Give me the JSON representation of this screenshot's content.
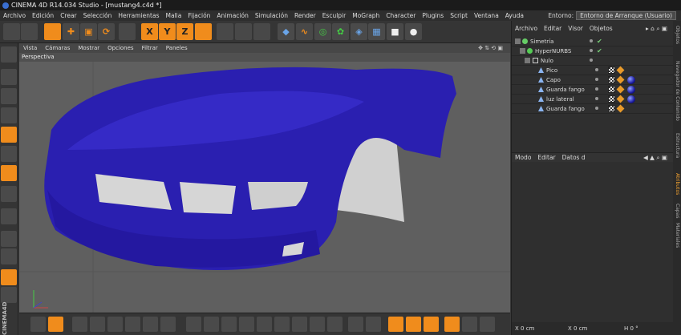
{
  "window": {
    "title": "CINEMA 4D R14.034 Studio - [mustang4.c4d *]"
  },
  "menu": [
    "Archivo",
    "Edición",
    "Crear",
    "Selección",
    "Herramientas",
    "Malla",
    "Fijación",
    "Animación",
    "Simulación",
    "Render",
    "Esculpir",
    "MoGraph",
    "Character",
    "Plugins",
    "Script",
    "Ventana",
    "Ayuda"
  ],
  "layout": {
    "label": "Entorno:",
    "value": "Entorno de Arranque (Usuario)"
  },
  "toolbar": {
    "x_label": "X",
    "y_label": "Y",
    "z_label": "Z"
  },
  "viewport": {
    "menu": [
      "Vista",
      "Cámaras",
      "Mostrar",
      "Opciones",
      "Filtrar",
      "Paneles"
    ],
    "name": "Perspectiva"
  },
  "object_manager": {
    "menu": [
      "Archivo",
      "Editar",
      "Visor",
      "Objetos"
    ],
    "items": [
      {
        "name": "Simetría"
      },
      {
        "name": "HyperNURBS"
      },
      {
        "name": "Nulo"
      },
      {
        "name": "Pico"
      },
      {
        "name": "Capo"
      },
      {
        "name": "Guarda fango"
      },
      {
        "name": "luz lateral"
      },
      {
        "name": "Guarda fango"
      }
    ]
  },
  "attribute_manager": {
    "menu": [
      "Modo",
      "Editar",
      "Datos d"
    ]
  },
  "coords": {
    "x": "X  0 cm",
    "x2": "X  0 cm",
    "h": "H  0 °"
  },
  "side_tabs": [
    "Objetos",
    "Navegador de Contenido",
    "Estructura",
    "Atributos",
    "Capas",
    "Materiales"
  ],
  "logo_side": "CINEMA4D",
  "colors": {
    "accent": "#f08c1c",
    "model": "#2a1fb0"
  }
}
